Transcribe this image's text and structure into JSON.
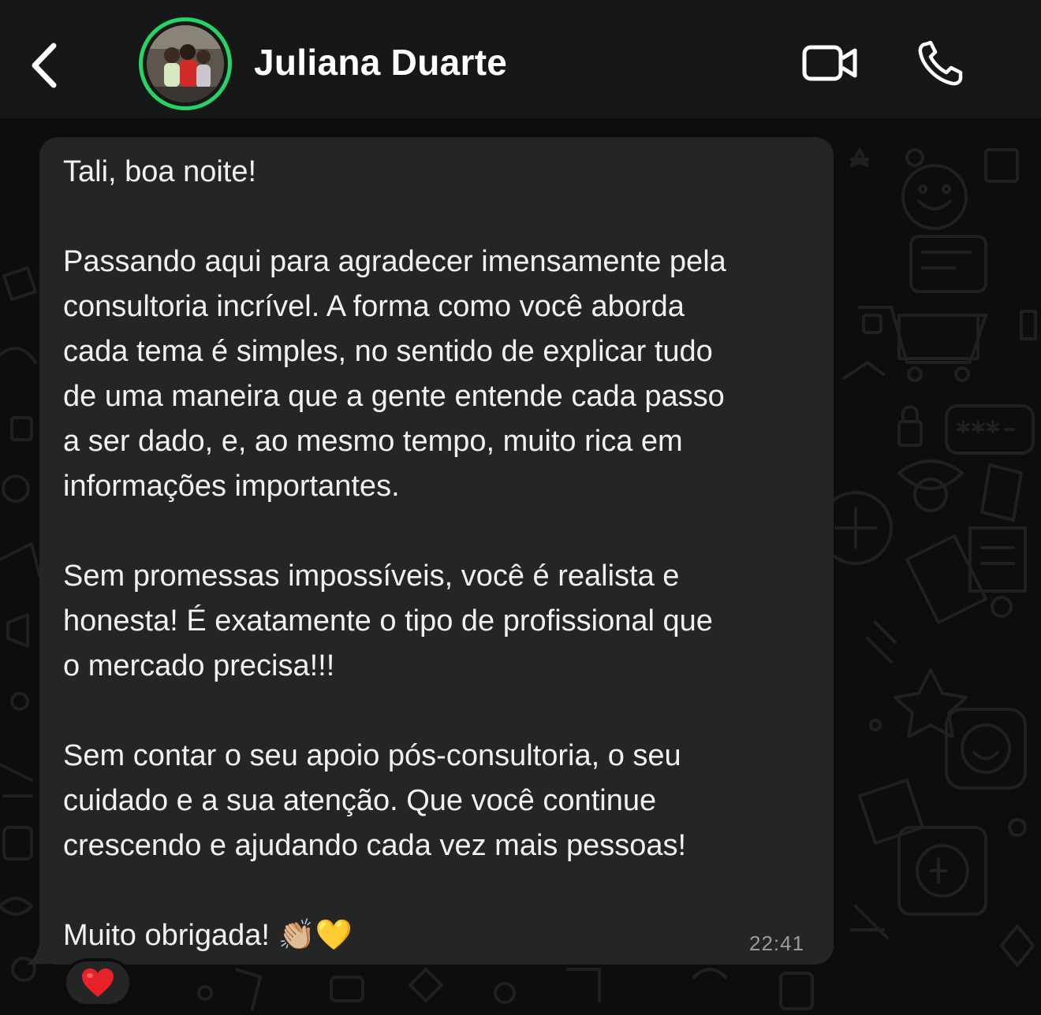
{
  "header": {
    "contact_name": "Juliana Duarte",
    "back_icon": "chevron-left-icon",
    "video_icon": "video-camera-icon",
    "call_icon": "phone-icon",
    "online_ring_color": "#25d366"
  },
  "message": {
    "text": "Tali, boa noite!\n\nPassando aqui para agradecer imensamente pela\nconsultoria incrível. A forma como você aborda\ncada tema é simples, no sentido de explicar tudo\nde uma maneira que a gente entende cada passo\na ser dado, e, ao mesmo tempo, muito rica em\ninformações importantes.\n\nSem promessas impossíveis, você é realista e\nhonesta! É exatamente o tipo de profissional que\no mercado precisa!!!\n\nSem contar o seu apoio pós-consultoria, o seu\ncuidado e a sua atenção. Que você continue\ncrescendo e ajudando cada vez mais pessoas!\n\nMuito obrigada! 👏🏼💛",
    "time": "22:41",
    "reaction": "❤️"
  },
  "colors": {
    "header_bg": "#161717",
    "bubble_bg": "#242626",
    "chat_bg": "#0c0d0d",
    "text": "#f1f1f1",
    "time": "#9a9c9c"
  }
}
